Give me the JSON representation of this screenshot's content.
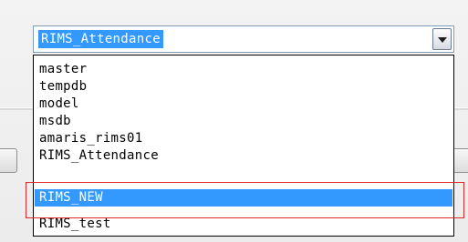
{
  "combo": {
    "selected_value": "RIMS_Attendance",
    "icon": "chevron-down-icon"
  },
  "dropdown": {
    "items": [
      {
        "label": "master",
        "selected": false
      },
      {
        "label": "tempdb",
        "selected": false
      },
      {
        "label": "model",
        "selected": false
      },
      {
        "label": "msdb",
        "selected": false
      },
      {
        "label": "amaris_rims01",
        "selected": false
      },
      {
        "label": "RIMS_Attendance",
        "selected": false
      },
      {
        "label": "RIMS_NEW",
        "selected": true
      },
      {
        "label": "RIMS_test",
        "selected": false
      }
    ]
  },
  "colors": {
    "selection": "#3399ff",
    "annotation": "#e02828",
    "combo_border": "#7f9db9"
  }
}
